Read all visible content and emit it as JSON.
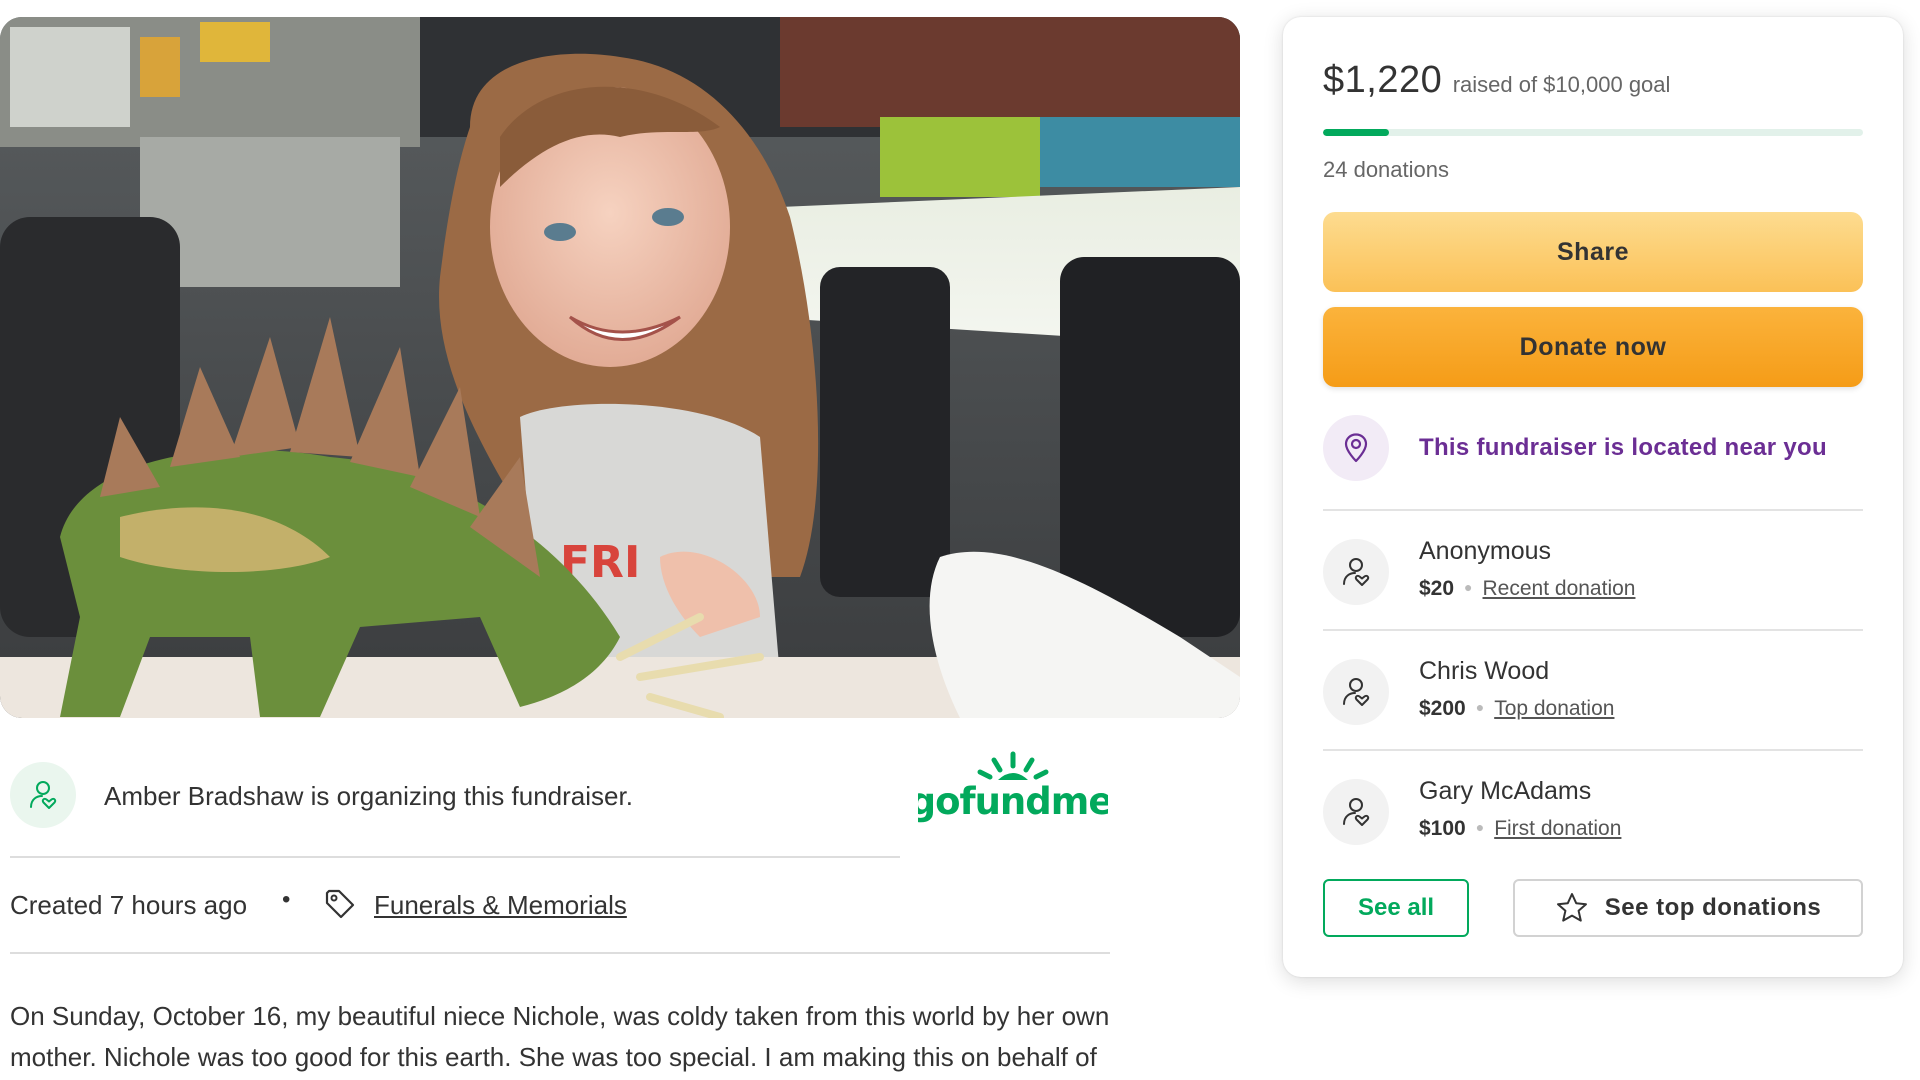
{
  "organizer": {
    "text": "Amber Bradshaw is organizing this fundraiser.",
    "icon": "user-heart-icon"
  },
  "brand": {
    "logo_text": "gofundme",
    "color": "#02a95c"
  },
  "meta": {
    "created": "Created 7 hours ago",
    "separator": "•",
    "category": "Funerals & Memorials",
    "category_icon": "tag-icon"
  },
  "story": {
    "text": "On Sunday, October 16, my beautiful niece Nichole, was coldy taken from this world by her own mother. Nichole was too good for this earth. She was too special. I am making this on behalf of my brother, James, Nichole's dad. Funds will be used for a final resting place for"
  },
  "donation_card": {
    "amount": "$1,220",
    "goal_text": "raised of $10,000 goal",
    "progress_fraction": 0.122,
    "donations_count": "24 donations",
    "share_label": "Share",
    "donate_label": "Donate now",
    "nearby_text": "This fundraiser is located near you",
    "nearby_icon": "location-pin-icon",
    "donors": [
      {
        "name": "Anonymous",
        "amount": "$20",
        "kind": "Recent donation"
      },
      {
        "name": "Chris Wood",
        "amount": "$200",
        "kind": "Top donation"
      },
      {
        "name": "Gary McAdams",
        "amount": "$100",
        "kind": "First donation"
      }
    ],
    "see_all_label": "See all",
    "see_top_label": "See top donations"
  },
  "colors": {
    "accent_green": "#02a95c",
    "share_yellow": "#fbc157",
    "donate_orange": "#f59c17",
    "nearby_purple": "#6b2e94"
  }
}
